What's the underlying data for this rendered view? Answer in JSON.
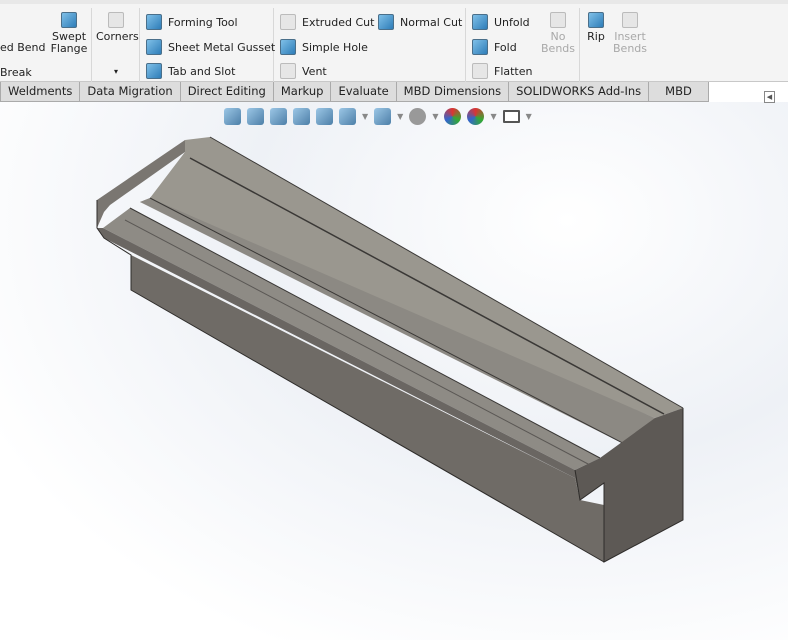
{
  "ribbon": {
    "g1": {
      "item1": "ed Bend",
      "item2": "Break",
      "swept": "Swept Flange"
    },
    "g2": {
      "corners": "Corners",
      "dropdown": "▾"
    },
    "g3": {
      "forming": "Forming Tool",
      "gusset": "Sheet Metal Gusset",
      "tab_slot": "Tab and Slot"
    },
    "g4": {
      "extruded": "Extruded Cut",
      "normal": "Normal Cut",
      "hole": "Simple Hole",
      "vent": "Vent"
    },
    "g5": {
      "unfold": "Unfold",
      "fold": "Fold",
      "flatten": "Flatten",
      "no_bends": "No Bends"
    },
    "g6": {
      "rip": "Rip",
      "insert_bends": "Insert Bends"
    }
  },
  "tabs": [
    "Weldments",
    "Data Migration",
    "Direct Editing",
    "Markup",
    "Evaluate",
    "MBD Dimensions",
    "SOLIDWORKS Add-Ins",
    "MBD"
  ],
  "colors": {
    "accent": "#2e7db8",
    "part_top": "#99968f",
    "part_front": "#6e6a65",
    "part_side": "#5c5854"
  }
}
